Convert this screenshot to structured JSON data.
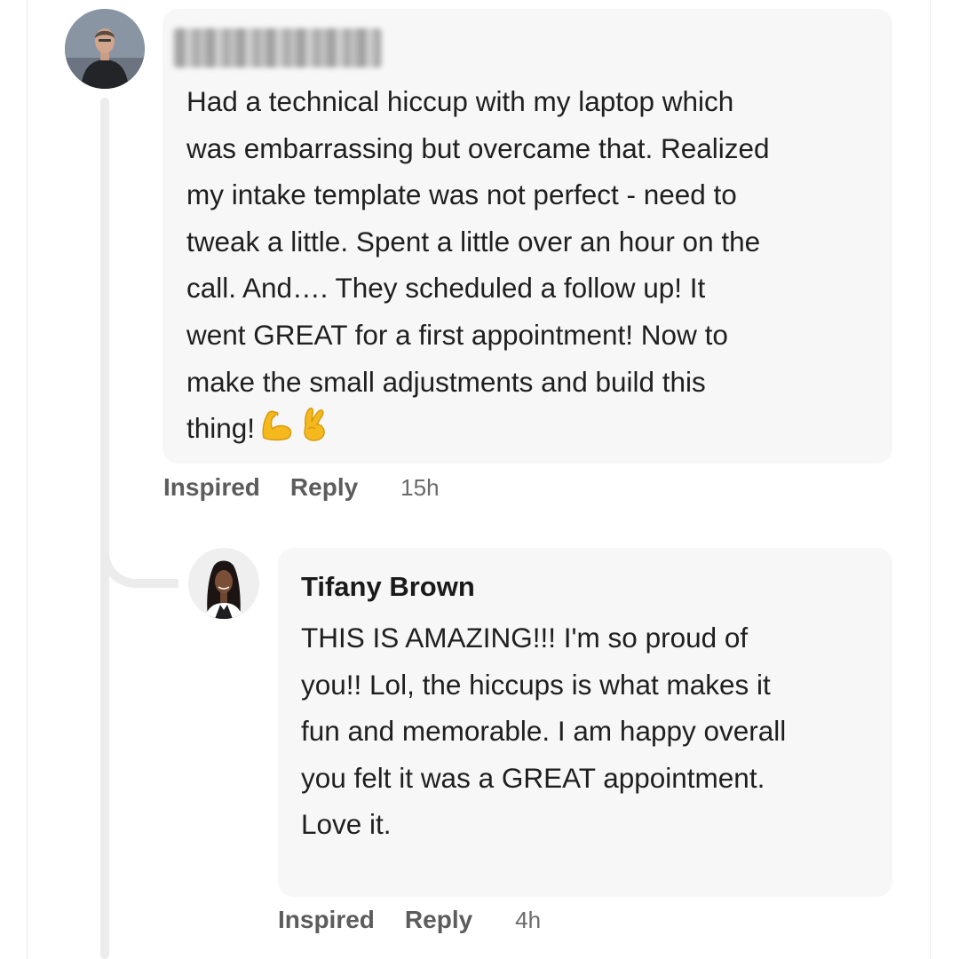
{
  "comments": [
    {
      "author": "",
      "text_lines": [
        "Had a technical hiccup with my laptop which",
        "was embarrassing but overcame that. Realized",
        "my intake template was not perfect - need to",
        "tweak a little. Spent a little over an hour on the",
        "call. And…. They scheduled a follow up! It",
        "went GREAT for a first appointment! Now to",
        "make the small adjustments and build this",
        "thing!"
      ],
      "emojis": [
        "💪",
        "🤞"
      ],
      "actions": {
        "reaction_label": "Inspired",
        "reply_label": "Reply",
        "time": "15h"
      }
    },
    {
      "author": "Tifany Brown",
      "text_lines": [
        "THIS IS AMAZING!!! I'm so proud of",
        "you!! Lol, the hiccups is what makes it",
        "fun and memorable. I am happy overall",
        "you felt it was a GREAT appointment.",
        "Love it."
      ],
      "actions": {
        "reaction_label": "Inspired",
        "reply_label": "Reply",
        "time": "4h"
      }
    }
  ],
  "colors": {
    "bubble_bg": "#f7f7f8",
    "thread_line": "#ececec",
    "action_text": "#5c5c5c"
  }
}
